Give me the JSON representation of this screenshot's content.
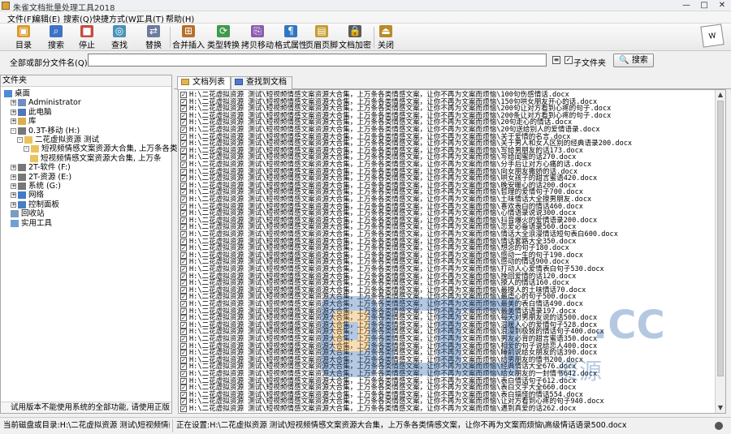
{
  "app": {
    "title": "朱雀文档批量处理工具2018"
  },
  "menu": [
    "文件(F)",
    "编辑(E)",
    "搜索(Q)",
    "快捷方式(W)",
    "工具(T)",
    "帮助(H)"
  ],
  "toolbar": [
    {
      "label": "目录",
      "icon": "folder-icon",
      "color": "#d89c2d"
    },
    {
      "label": "搜索",
      "icon": "search-icon",
      "color": "#3d73c7"
    },
    {
      "label": "停止",
      "icon": "stop-icon",
      "color": "#c64b41"
    },
    {
      "label": "查找",
      "icon": "find-icon",
      "color": "#4a92b9"
    },
    {
      "label": "替换",
      "icon": "replace-icon",
      "color": "#6a7b9d"
    },
    {
      "label": "合并插入",
      "icon": "merge-icon",
      "color": "#b86f2a"
    },
    {
      "label": "类型转换",
      "icon": "convert-icon",
      "color": "#3f9a4c"
    },
    {
      "label": "拷贝移动",
      "icon": "copy-icon",
      "color": "#8c5bb0"
    },
    {
      "label": "格式属性",
      "icon": "format-icon",
      "color": "#3176c2"
    },
    {
      "label": "页眉页脚",
      "icon": "header-footer-icon",
      "color": "#c69c30"
    },
    {
      "label": "文档加密",
      "icon": "lock-icon",
      "color": "#5a5a5a"
    },
    {
      "label": "关闭",
      "icon": "exit-icon",
      "color": "#ba8a2a"
    }
  ],
  "search": {
    "label": "全部或部分文件名(Q)",
    "value": "",
    "subfolder_label": "子文件夹",
    "button_label": "搜索"
  },
  "tree": {
    "header": "文件夹",
    "items": [
      {
        "label": "桌面",
        "indent": 0,
        "expander": "",
        "color": "#4d8cd6"
      },
      {
        "label": "Administrator",
        "indent": 1,
        "expander": "+",
        "color": "#6e8fbf"
      },
      {
        "label": "此电脑",
        "indent": 1,
        "expander": "+",
        "color": "#5276b8"
      },
      {
        "label": "库",
        "indent": 1,
        "expander": "+",
        "color": "#d8b04f"
      },
      {
        "label": "0.3T-移动 (H:)",
        "indent": 1,
        "expander": "-",
        "color": "#777777"
      },
      {
        "label": "二花虚拟资源 测试",
        "indent": 2,
        "expander": "-",
        "color": "#e9c35d"
      },
      {
        "label": "短视频情感文案资源大合集, 上万条各类",
        "indent": 3,
        "expander": "-",
        "color": "#e9c35d"
      },
      {
        "label": "短视频情感文案资源大合集, 上万条",
        "indent": 4,
        "expander": "",
        "color": "#e9c35d"
      },
      {
        "label": "2T-软件 (F:)",
        "indent": 1,
        "expander": "+",
        "color": "#777777"
      },
      {
        "label": "2T-资源 (E:)",
        "indent": 1,
        "expander": "+",
        "color": "#777777"
      },
      {
        "label": "系统 (G:)",
        "indent": 1,
        "expander": "+",
        "color": "#777777"
      },
      {
        "label": "网络",
        "indent": 1,
        "expander": "+",
        "color": "#3f7bc6"
      },
      {
        "label": "控制面板",
        "indent": 1,
        "expander": "+",
        "color": "#4b7ec0"
      },
      {
        "label": "回收站",
        "indent": 1,
        "expander": "",
        "color": "#7a9cc0"
      },
      {
        "label": "实用工具",
        "indent": 1,
        "expander": "",
        "color": "#6fa0d4"
      }
    ],
    "tip": "试用版本不能使用系统的全部功能, 请使用正版"
  },
  "tabs": [
    "文档列表",
    "查找到文档"
  ],
  "file_prefix": "H:\\二花虚拟资源 测试\\短视频情感文案资源大合集，上万条各类情感文案，让你不再为文案而烦恼\\",
  "files": [
    "100句伤感情话.docx",
    "150句哄女朋友开心的话.docx",
    "200句让对方看到心疼的句子.docx",
    "200条让对方看到心疼的句子.docx",
    "20句走心的情话.docx",
    "20句送给别人的爱情语录.docx",
    "关于爱情的名言.docx",
    "关于男人和女人区别的经典语录200.docx",
    "写给男朋友的话173.docx",
    "写给闺蜜的话270.docx",
    "分手后让对方心痛的话.docx",
    "向女朋友撒娇的话.docx",
    "哄女孩子的甜言蜜语420.docx",
    "晚安暖心的话200.docx",
    "哲理的爱情句子700.docx",
    "土味情话大全撩男朋友.docx",
    "喜欢表白的情话460.docx",
    "心情语录说说300.docx",
    "抖音爆火的爱情语录200.docx",
    "恋爱必备语录560.docx",
    "情话大全浪漫情话短句表白600.docx",
    "情话套路大全350.docx",
    "想念的句子180.docx",
    "感动一生的句子190.docx",
    "感动的情话900.docx",
    "打动人心爱情表白句子530.docx",
    "挽回爱情的话120.docx",
    "撩人的情话160.docx",
    "最撩人的土味情话70.docx",
    "最虐心的句子500.docx",
    "最美的表白情话490.docx",
    "最美情话语录197.docx",
    "每天对男朋友说的话500.docx",
    "温暖人心的爱情句子528.docx",
    "浪漫到极致的情话句子400.docx",
    "男友必背的甜言蜜语350.docx",
    "相爱的句子说给恋人400.docx",
    "睡前说给女朋友的话390.docx",
    "给男朋友的情书200.docx",
    "经典情话大全676.docx",
    "给女朋友的一封情书642.docx",
    "表白情话句子612.docx",
    "表白文字大全660.docx",
    "表白搞怪的情话554.docx",
    "让对方看到心疼的句子940.docx",
    "遇到真爱的话262.docx"
  ],
  "status": {
    "current_dir": "当前磁盘或目录:H:\\二花虚拟资源 测试\\短视频情感文案资",
    "processing": "正在设置:H:\\二花虚拟资源 测试\\短视频情感文案资源大合集，上万条各类情感文案，让你不再为文案而烦恼\\高级情话语录500.docx"
  },
  "watermark_text": "资源",
  "watermark_domain": ".CC",
  "colors": {
    "watermark_blue": "#1f5aa8",
    "watermark_orange": "#e89a21"
  }
}
